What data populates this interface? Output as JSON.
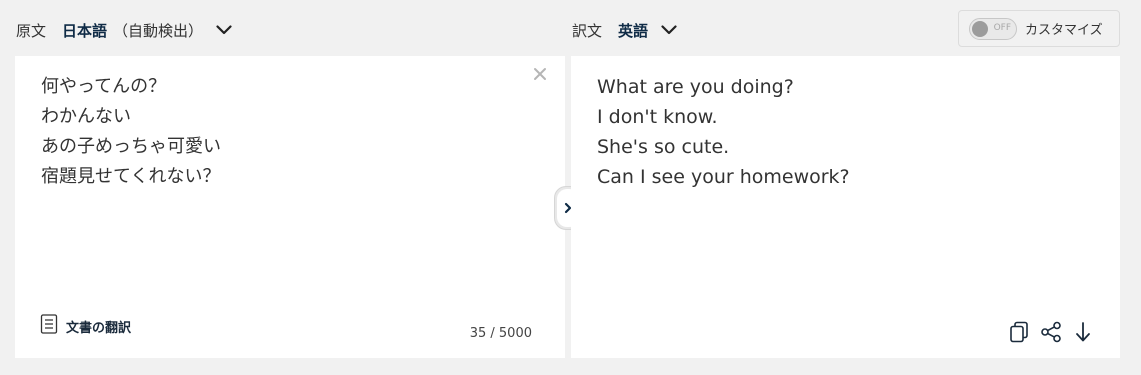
{
  "source": {
    "caption": "原文",
    "language": "日本語",
    "detect": "（自動検出）",
    "lines": [
      "何やってんの？",
      "わかんない",
      "あの子めっちゃ可愛い",
      "宿題見せてくれない？"
    ],
    "doc_translate_label": "文書の翻訳",
    "char_count": "35 / 5000"
  },
  "target": {
    "caption": "訳文",
    "language": "英語",
    "lines": [
      "What are you doing?",
      "I don't know.",
      "She's so cute.",
      "Can I see your homework?"
    ]
  },
  "customize": {
    "toggle_state": "OFF",
    "label": "カスタマイズ"
  },
  "icons": {
    "source_dropdown": "chevron-down-icon",
    "target_dropdown": "chevron-down-icon",
    "clear": "close-icon",
    "document": "document-icon",
    "swap": "chevron-right-icon",
    "copy": "copy-icon",
    "share": "share-icon",
    "download": "arrow-down-icon"
  },
  "colors": {
    "background": "#f1f1f1",
    "panel": "#ffffff",
    "language_accent": "#0f2b46"
  }
}
